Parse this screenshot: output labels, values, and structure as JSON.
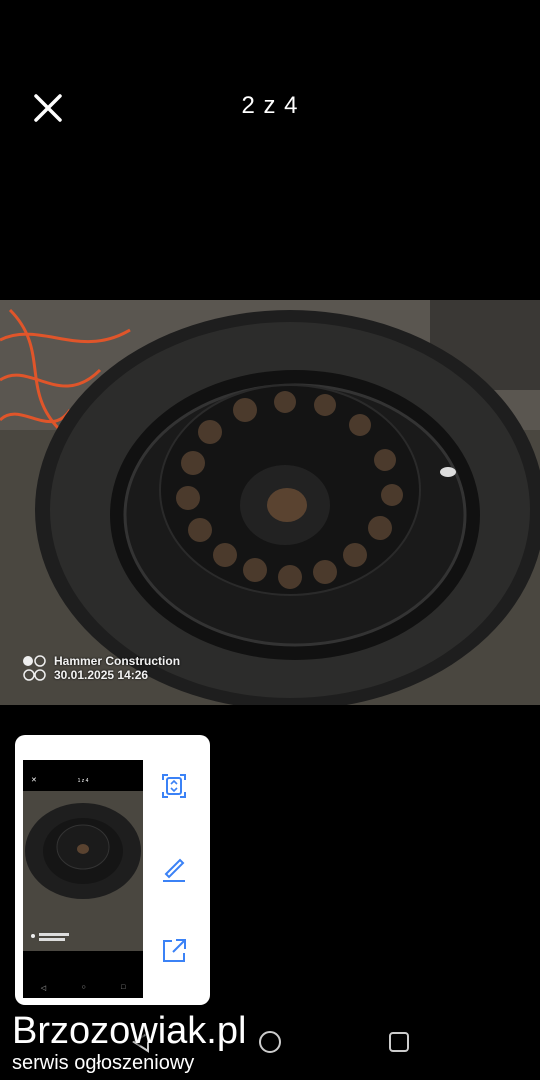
{
  "header": {
    "counter": "2 z 4",
    "close_icon": "close-icon"
  },
  "photo": {
    "stamp_title": "Hammer Construction",
    "stamp_datetime": "30.01.2025 14:26"
  },
  "share_card": {
    "thumbnail": {
      "counter": "1 z 4"
    },
    "actions": [
      {
        "icon": "scan-icon"
      },
      {
        "icon": "edit-icon"
      },
      {
        "icon": "share-icon"
      }
    ]
  },
  "nav": {
    "back": "back-icon",
    "home": "home-icon",
    "recents": "recents-icon"
  },
  "watermark": {
    "brand": "Brzozowiak.pl",
    "tagline": "serwis ogłoszeniowy"
  },
  "colors": {
    "background": "#000000",
    "accent": "#3b82f6",
    "card": "#ffffff"
  }
}
